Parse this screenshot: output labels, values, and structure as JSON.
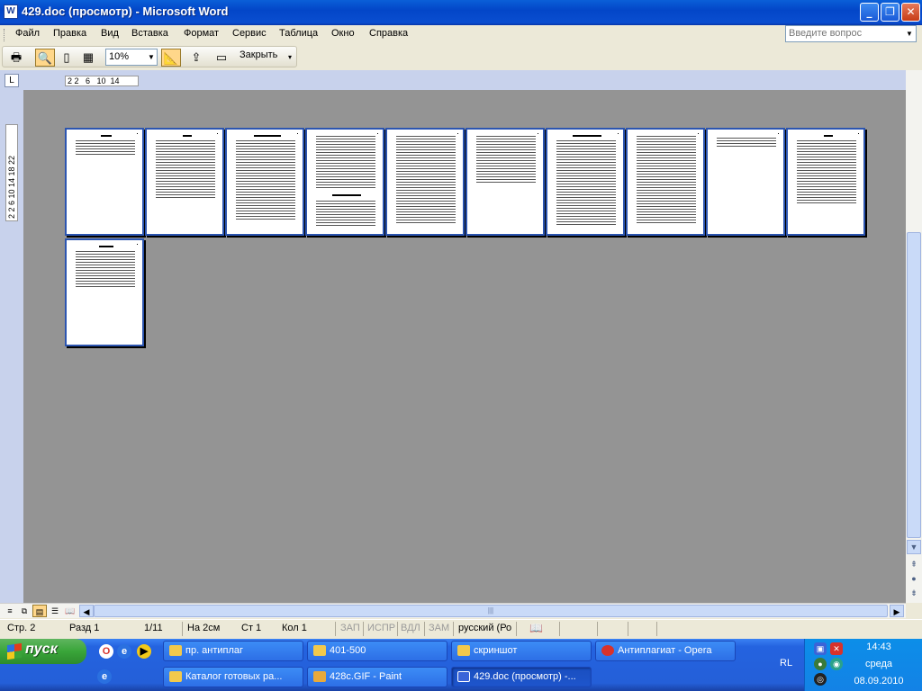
{
  "window": {
    "title": "429.doc (просмотр) - Microsoft Word",
    "app_icon_letter": "W",
    "controls": {
      "minimize": "_",
      "maximize": "❐",
      "close": "✕"
    }
  },
  "menu": [
    "Файл",
    "Правка",
    "Вид",
    "Вставка",
    "Формат",
    "Сервис",
    "Таблица",
    "Окно",
    "Справка"
  ],
  "help_box": {
    "placeholder": "Введите вопрос"
  },
  "toolbar": {
    "zoom": "10%",
    "close_label": "Закрыть"
  },
  "ruler": {
    "corner": "L",
    "horizontal": "2 2   6   10  14",
    "vertical": "2  2  6  10  14  18  22"
  },
  "preview": {
    "page_count": 11
  },
  "view_buttons": [
    "≡",
    "⧉",
    "▤",
    "☰",
    "📖"
  ],
  "status": {
    "page": "Стр. 2",
    "section": "Разд 1",
    "pages": "1/11",
    "at": "На 2см",
    "line": "Ст 1",
    "col": "Кол 1",
    "rec": "ЗАП",
    "trk": "ИСПР",
    "ext": "ВДЛ",
    "ovr": "ЗАМ",
    "language": "русский (Ро"
  },
  "taskbar": {
    "start_label": "пуск",
    "tasks_row1": [
      {
        "label": "пр. антиплаг",
        "color": "#f2c94c"
      },
      {
        "label": "401-500",
        "color": "#f2c94c"
      },
      {
        "label": "скриншот",
        "color": "#f2c94c"
      },
      {
        "label": "Антиплагиат - Opera",
        "color": "#d8322b"
      }
    ],
    "tasks_row2": [
      {
        "label": "Каталог готовых ра...",
        "color": "#f2c94c"
      },
      {
        "label": "428c.GIF - Paint",
        "color": "#e8a93a"
      },
      {
        "label": "429.doc (просмотр) -...",
        "color": "#3a64d8"
      }
    ],
    "language": "RL",
    "time": "14:43",
    "weekday": "среда",
    "date": "08.09.2010"
  }
}
